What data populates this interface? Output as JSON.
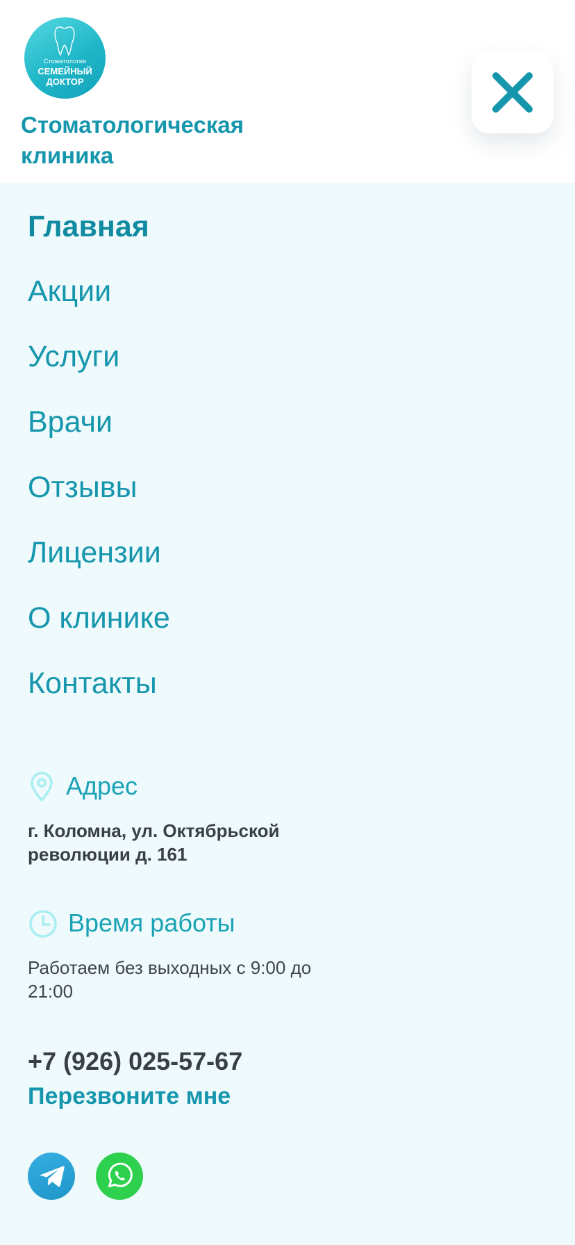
{
  "header": {
    "logo": {
      "line1": "Стоматология",
      "line2": "СЕМЕЙНЫЙ",
      "line3": "ДОКТОР"
    },
    "title": "Стоматологическая клиника",
    "close_icon": "close-icon"
  },
  "menu": {
    "items": [
      {
        "label": "Главная",
        "active": true
      },
      {
        "label": "Акции"
      },
      {
        "label": "Услуги"
      },
      {
        "label": "Врачи"
      },
      {
        "label": "Отзывы"
      },
      {
        "label": "Лицензии"
      },
      {
        "label": "О клинике"
      },
      {
        "label": "Контакты"
      }
    ]
  },
  "address": {
    "icon": "location-pin-icon",
    "heading": "Адрес",
    "text": "г. Коломна, ул. Октябрьской революции д. 161"
  },
  "hours": {
    "icon": "clock-icon",
    "heading": "Время работы",
    "text": "Работаем без выходных с 9:00 до 21:00"
  },
  "contact": {
    "phone": "+7 (926) 025-57-67",
    "callback_label": "Перезвоните мне"
  },
  "social": [
    {
      "icon": "telegram-icon"
    },
    {
      "icon": "whatsapp-icon"
    }
  ],
  "colors": {
    "primary": "#1596ad",
    "background": "#eefafc",
    "text_dark": "#3a3f47",
    "icon_light": "#a9eef2"
  }
}
